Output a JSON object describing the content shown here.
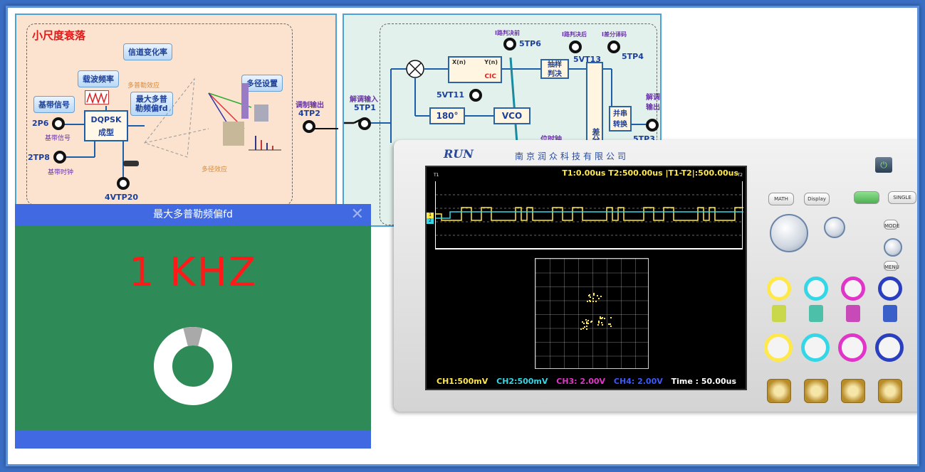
{
  "fading": {
    "title": "小尺度衰落",
    "channel_rate": "信道变化率",
    "carrier_freq": "载波频率",
    "doppler_effect": "多普勒效应",
    "max_doppler_line1": "最大多普",
    "max_doppler_line2": "勒频偏fd",
    "multipath_setting": "多径设置",
    "baseband_signal_btn": "基带信号",
    "dqpsk_line1": "DQPSK",
    "dqpsk_line2": "成型",
    "tp_2p6": "2P6",
    "baseband_signal_lbl": "基带信号",
    "tp_2tp8": "2TP8",
    "baseband_clock_lbl": "基带时钟",
    "tp_4vtp20": "4VTP20",
    "multipath_effect": "多径效应",
    "mod_out": "调制输出",
    "tp_4tp2": "4TP2"
  },
  "demod": {
    "demod_in": "解调输入",
    "tp_5tp1": "5TP1",
    "i_before": "I路判决前",
    "tp_5tp6": "5TP6",
    "i_after": "I路判决后",
    "tp_5vt13": "5VT13",
    "i_diff": "I差分译码",
    "tp_5tp4": "5TP4",
    "cic": "CIC",
    "xn": "X(n)",
    "yn": "Y(n)",
    "sample_line1": "抽样",
    "sample_line2": "判决",
    "tp_5vt11": "5VT11",
    "phase": "180°",
    "vco": "VCO",
    "diff_decode": "差分码译",
    "ps_line1": "并串",
    "ps_line2": "转换",
    "demod_out_line1": "解调",
    "demod_out_line2": "输出",
    "tp_5tp3": "5TP3",
    "bit_clock": "位时钟"
  },
  "scope": {
    "brand": "RUN",
    "company": "南京润众科技有限公司",
    "t_line": "T1:0.00us    T2:500.00us  |T1-T2|:500.00us",
    "t1_marker": "T1",
    "t2_marker": "T2",
    "ch_marker_1": "1",
    "ch_marker_2": "2",
    "ch1": "CH1:500mV",
    "ch2": "CH2:500mV",
    "ch3": "CH3:  2.00V",
    "ch4": "CH4:  2.00V",
    "time": "Time : 50.00us",
    "btn_math": "MATH",
    "btn_display": "Display",
    "btn_single": "SINGLE",
    "btn_mode": "MODE",
    "btn_menu": "MENU",
    "colors": {
      "ch1": "#ffe84a",
      "ch2": "#35d7e6",
      "ch3": "#e035c8",
      "ch4": "#3b59ff"
    }
  },
  "popup": {
    "title": "最大多普勒频偏fd",
    "value": "1 KHZ",
    "close_icon": "close-icon",
    "gauge_fraction": 0.08
  }
}
